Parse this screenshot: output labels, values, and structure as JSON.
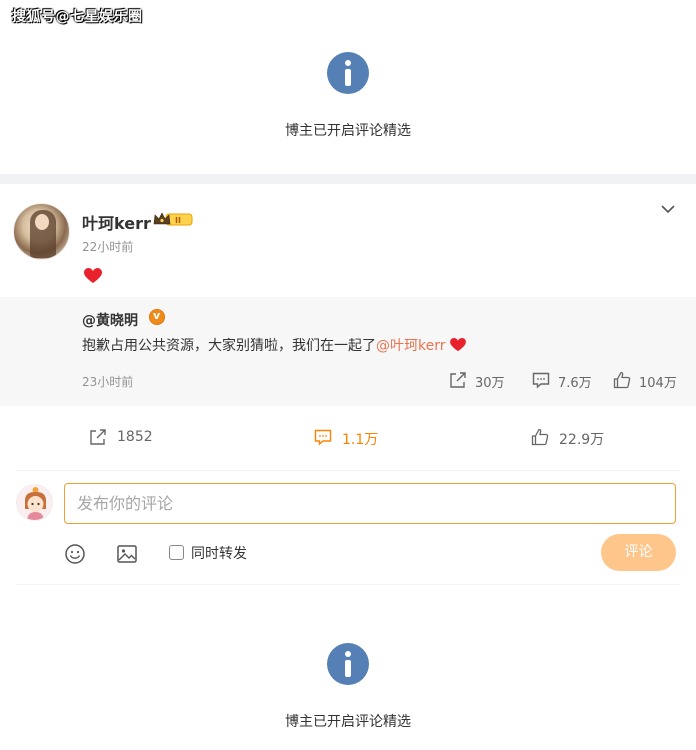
{
  "watermark": "搜狐号@七星娱乐圈",
  "notice_top": {
    "text": "博主已开启评论精选"
  },
  "post": {
    "username": "叶珂kerr",
    "time": "22小时前",
    "repost": {
      "author": "@黄晓明",
      "text_prefix": "抱歉占用公共资源，大家别猜啦，我们在一起了",
      "mention": "@叶珂kerr",
      "time": "23小时前",
      "shares": "30万",
      "comments": "7.6万",
      "likes": "104万"
    },
    "actions": {
      "shares": "1852",
      "comments": "1.1万",
      "likes": "22.9万"
    }
  },
  "composer": {
    "placeholder": "发布你的评论",
    "checkbox_label": "同时转发",
    "submit_label": "评论"
  },
  "notice_bottom": {
    "text": "博主已开启评论精选"
  },
  "colors": {
    "accent": "#ff8200",
    "mention": "#eb7350",
    "info_icon": "#5480b6",
    "submit_disabled": "#ffc68c"
  }
}
